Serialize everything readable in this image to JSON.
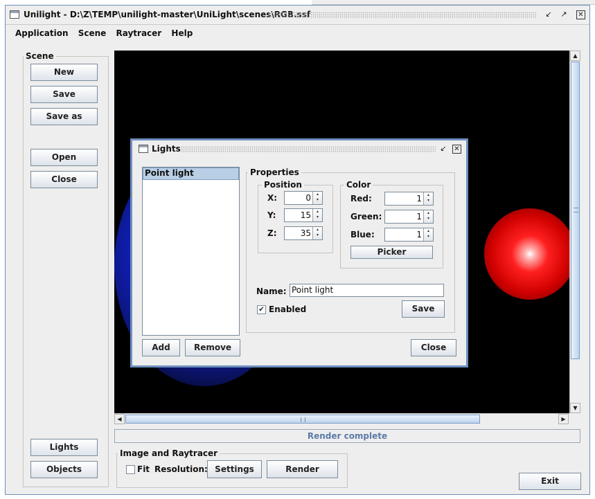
{
  "window": {
    "title": "Unilight - D:\\Z\\TEMP\\unilight-master\\UniLight\\scenes\\RGB.ssf",
    "controls": {
      "minimize_icon": "↙",
      "maximize_icon": "↗",
      "close_icon": "✕"
    }
  },
  "menubar": {
    "items": [
      "Application",
      "Scene",
      "Raytracer",
      "Help"
    ]
  },
  "scene_panel": {
    "title": "Scene",
    "buttons": {
      "new": "New",
      "save": "Save",
      "save_as": "Save as",
      "open": "Open",
      "close": "Close"
    }
  },
  "bottom_left": {
    "lights": "Lights",
    "objects": "Objects"
  },
  "status": {
    "text": "Render complete"
  },
  "image_raytracer": {
    "title": "Image and Raytracer",
    "fit_label": "Fit",
    "fit_checked": false,
    "resolution_label": "Resolution:",
    "settings_button": "Settings",
    "render_button": "Render"
  },
  "exit_button": "Exit",
  "scroll": {
    "vertical_position": 0.0,
    "horizontal_position": 0.0
  },
  "lights_dialog": {
    "title": "Lights",
    "list_items": [
      "Point light"
    ],
    "selected_index": 0,
    "properties_label": "Properties",
    "position": {
      "label": "Position",
      "x_label": "X:",
      "x": "0",
      "y_label": "Y:",
      "y": "15",
      "z_label": "Z:",
      "z": "35"
    },
    "color": {
      "label": "Color",
      "red_label": "Red:",
      "red": "1",
      "green_label": "Green:",
      "green": "1",
      "blue_label": "Blue:",
      "blue": "1",
      "picker_button": "Picker"
    },
    "name_label": "Name:",
    "name_value": "Point light",
    "enabled_label": "Enabled",
    "enabled_checked": true,
    "save_button": "Save",
    "add_button": "Add",
    "remove_button": "Remove",
    "close_button": "Close"
  },
  "colors": {
    "frame_border": "#6d8fb7",
    "dialog_border": "#6d8fbf",
    "viewport_bg": "#000000",
    "status_text": "#5b7ba8",
    "red_sphere": "#ff1010",
    "blue_sphere": "#1020c0"
  }
}
